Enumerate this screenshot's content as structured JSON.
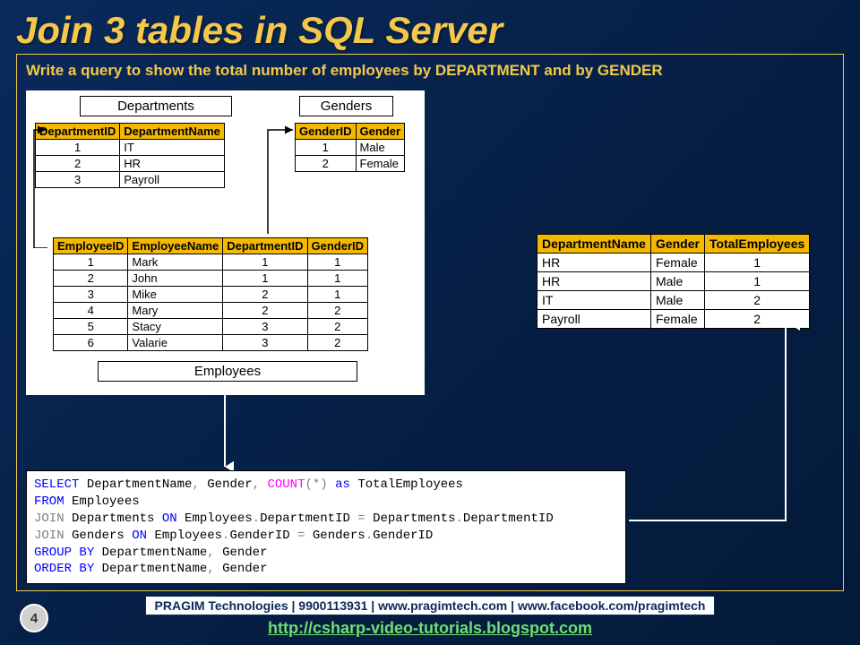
{
  "title": "Join 3 tables in SQL Server",
  "subtitle": "Write a query to show the total number of employees by DEPARTMENT and by GENDER",
  "labels": {
    "departments": "Departments",
    "genders": "Genders",
    "employees": "Employees"
  },
  "departments": {
    "cols": [
      "DepartmentID",
      "DepartmentName"
    ],
    "rows": [
      [
        "1",
        "IT"
      ],
      [
        "2",
        "HR"
      ],
      [
        "3",
        "Payroll"
      ]
    ]
  },
  "genders": {
    "cols": [
      "GenderID",
      "Gender"
    ],
    "rows": [
      [
        "1",
        "Male"
      ],
      [
        "2",
        "Female"
      ]
    ]
  },
  "employees": {
    "cols": [
      "EmployeeID",
      "EmployeeName",
      "DepartmentID",
      "GenderID"
    ],
    "rows": [
      [
        "1",
        "Mark",
        "1",
        "1"
      ],
      [
        "2",
        "John",
        "1",
        "1"
      ],
      [
        "3",
        "Mike",
        "2",
        "1"
      ],
      [
        "4",
        "Mary",
        "2",
        "2"
      ],
      [
        "5",
        "Stacy",
        "3",
        "2"
      ],
      [
        "6",
        "Valarie",
        "3",
        "2"
      ]
    ]
  },
  "result": {
    "cols": [
      "DepartmentName",
      "Gender",
      "TotalEmployees"
    ],
    "rows": [
      [
        "HR",
        "Female",
        "1"
      ],
      [
        "HR",
        "Male",
        "1"
      ],
      [
        "IT",
        "Male",
        "2"
      ],
      [
        "Payroll",
        "Female",
        "2"
      ]
    ]
  },
  "sql": {
    "t1": "SELECT",
    "t2": " DepartmentName",
    "t3": ",",
    "t4": " Gender",
    "t5": ",",
    "t6": " COUNT",
    "t7": "(*)",
    "t8": " as",
    "t9": " TotalEmployees",
    "t10": "FROM",
    "t11": " Employees",
    "t12": "JOIN",
    "t13": " Departments ",
    "t14": "ON",
    "t15": " Employees",
    "t16": ".",
    "t17": "DepartmentID ",
    "t18": "=",
    "t19": " Departments",
    "t20": ".",
    "t21": "DepartmentID",
    "t22": "JOIN",
    "t23": " Genders ",
    "t24": "ON",
    "t25": " Employees",
    "t26": ".",
    "t27": "GenderID ",
    "t28": "=",
    "t29": " Genders",
    "t30": ".",
    "t31": "GenderID",
    "t32": "GROUP",
    "t33": " BY",
    "t34": " DepartmentName",
    "t35": ",",
    "t36": " Gender",
    "t37": "ORDER",
    "t38": " BY",
    "t39": " DepartmentName",
    "t40": ",",
    "t41": " Gender"
  },
  "footer_banner": "PRAGIM Technologies | 9900113931 | www.pragimtech.com | www.facebook.com/pragimtech",
  "footer_link": "http://csharp-video-tutorials.blogspot.com",
  "slide_number": "4"
}
